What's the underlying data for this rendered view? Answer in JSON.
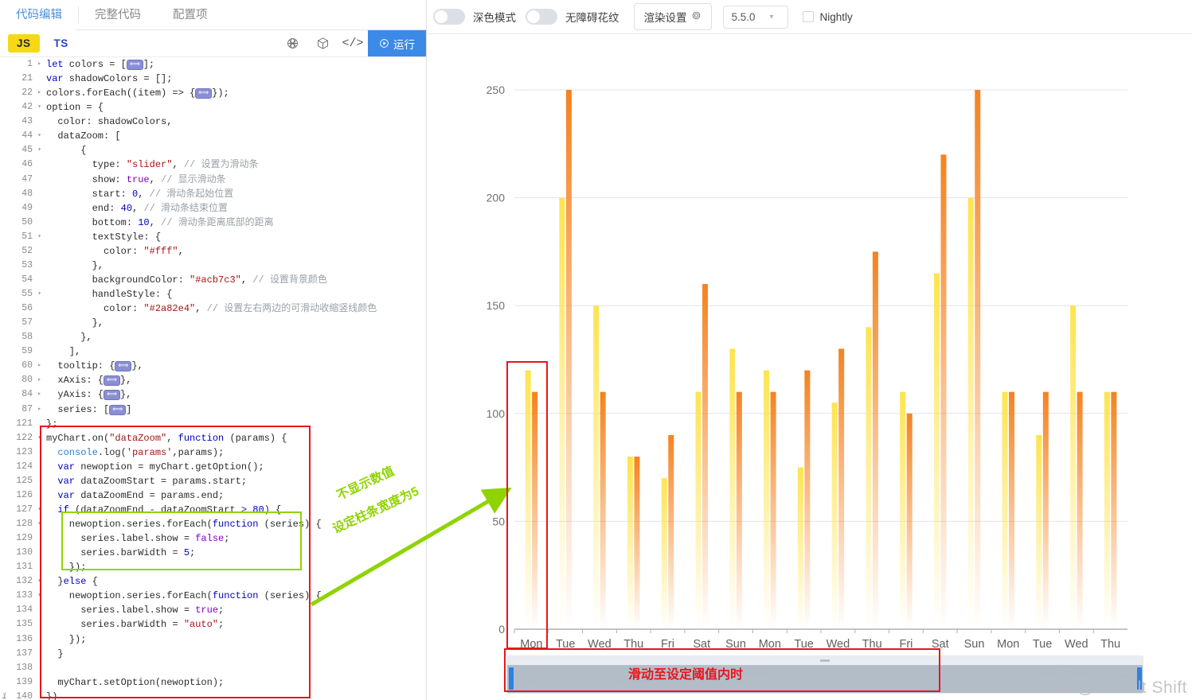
{
  "left_panel": {
    "tabs": [
      {
        "label": "代码编辑",
        "active": true
      },
      {
        "label": "完整代码",
        "active": false
      },
      {
        "label": "配置项",
        "active": false
      }
    ],
    "toolbar": {
      "lang_js": "JS",
      "lang_ts": "TS",
      "icon_globe": "globe-wireframe-icon",
      "icon_cube": "cube-icon",
      "icon_code": "</>",
      "run_label": "运行"
    },
    "code_lines": [
      {
        "n": "1",
        "fold": "▸",
        "html": "<span class='kw'>let</span> colors = [<span class='collapsed'>⟺</span>];"
      },
      {
        "n": "21",
        "fold": "",
        "html": "<span class='kw'>var</span> shadowColors = [];"
      },
      {
        "n": "22",
        "fold": "▸",
        "html": "colors.forEach((item) =&gt; {<span class='collapsed'>⟺</span>});"
      },
      {
        "n": "42",
        "fold": "▾",
        "html": "option = {"
      },
      {
        "n": "43",
        "fold": "",
        "html": "  color: shadowColors,"
      },
      {
        "n": "44",
        "fold": "▾",
        "html": "  dataZoom: ["
      },
      {
        "n": "45",
        "fold": "▾",
        "html": "      {"
      },
      {
        "n": "46",
        "fold": "",
        "html": "        type: <span class='str'>\"slider\"</span>, <span class='cmt'>// 设置为滑动条</span>"
      },
      {
        "n": "47",
        "fold": "",
        "html": "        show: <span class='kw2'>true</span>, <span class='cmt'>// 显示滑动条</span>"
      },
      {
        "n": "48",
        "fold": "",
        "html": "        start: <span class='num'>0</span>, <span class='cmt'>// 滑动条起始位置</span>"
      },
      {
        "n": "49",
        "fold": "",
        "html": "        end: <span class='num'>40</span>, <span class='cmt'>// 滑动条结束位置</span>"
      },
      {
        "n": "50",
        "fold": "",
        "html": "        bottom: <span class='num'>10</span>, <span class='cmt'>// 滑动条距离底部的距离</span>"
      },
      {
        "n": "51",
        "fold": "▾",
        "html": "        textStyle: {"
      },
      {
        "n": "52",
        "fold": "",
        "html": "          color: <span class='str'>\"#fff\"</span>,"
      },
      {
        "n": "53",
        "fold": "",
        "html": "        },"
      },
      {
        "n": "54",
        "fold": "",
        "html": "        backgroundColor: <span class='str'>\"#acb7c3\"</span>, <span class='cmt'>// 设置背景颜色</span>"
      },
      {
        "n": "55",
        "fold": "▾",
        "html": "        handleStyle: {"
      },
      {
        "n": "56",
        "fold": "",
        "html": "          color: <span class='str'>\"#2a82e4\"</span>, <span class='cmt'>// 设置左右两边的可滑动收缩竖线颜色</span>"
      },
      {
        "n": "57",
        "fold": "",
        "html": "        },"
      },
      {
        "n": "58",
        "fold": "",
        "html": "      },"
      },
      {
        "n": "59",
        "fold": "",
        "html": "    ],"
      },
      {
        "n": "60",
        "fold": "▸",
        "html": "  tooltip: {<span class='collapsed'>⟺</span>},"
      },
      {
        "n": "80",
        "fold": "▸",
        "html": "  xAxis: {<span class='collapsed'>⟺</span>},"
      },
      {
        "n": "84",
        "fold": "▸",
        "html": "  yAxis: {<span class='collapsed'>⟺</span>},"
      },
      {
        "n": "87",
        "fold": "▸",
        "html": "  series: [<span class='collapsed'>⟺</span>]"
      },
      {
        "n": "121",
        "fold": "",
        "html": "};"
      },
      {
        "n": "122",
        "fold": "▾",
        "html": "myChart.on(<span class='str'>\"dataZoom\"</span>, <span class='kw'>function</span> (params) {"
      },
      {
        "n": "123",
        "fold": "",
        "html": "  <span class='fn'>console</span>.log(<span class='str'>'params'</span>,params);"
      },
      {
        "n": "124",
        "fold": "",
        "html": "  <span class='kw'>var</span> newoption = myChart.getOption();"
      },
      {
        "n": "125",
        "fold": "",
        "html": "  <span class='kw'>var</span> dataZoomStart = params.start;"
      },
      {
        "n": "126",
        "fold": "",
        "html": "  <span class='kw'>var</span> dataZoomEnd = params.end;"
      },
      {
        "n": "127",
        "fold": "▾",
        "html": "  <span class='kw'>if</span> (dataZoomEnd - dataZoomStart &gt; <span class='num'>80</span>) {"
      },
      {
        "n": "128",
        "fold": "▾",
        "html": "    newoption.series.forEach(<span class='kw'>function</span> (series) {"
      },
      {
        "n": "129",
        "fold": "",
        "html": "      series.label.show = <span class='kw2'>false</span>;"
      },
      {
        "n": "130",
        "fold": "",
        "html": "      series.barWidth = <span class='num'>5</span>;"
      },
      {
        "n": "131",
        "fold": "",
        "html": "    });"
      },
      {
        "n": "132",
        "fold": "▾",
        "html": "  }<span class='kw'>else</span> {"
      },
      {
        "n": "133",
        "fold": "▾",
        "html": "    newoption.series.forEach(<span class='kw'>function</span> (series) {"
      },
      {
        "n": "134",
        "fold": "",
        "html": "      series.label.show = <span class='kw2'>true</span>;"
      },
      {
        "n": "135",
        "fold": "",
        "html": "      series.barWidth = <span class='str'>\"auto\"</span>;"
      },
      {
        "n": "136",
        "fold": "",
        "html": "    });"
      },
      {
        "n": "137",
        "fold": "",
        "html": "  }"
      },
      {
        "n": "138",
        "fold": "",
        "html": ""
      },
      {
        "n": "139",
        "fold": "",
        "html": "  myChart.setOption(newoption);"
      },
      {
        "n": "140",
        "fold": "",
        "gutter_icon": "i",
        "html": "})"
      }
    ]
  },
  "top_toolbar": {
    "dark_mode_label": "深色模式",
    "dark_mode_on": false,
    "pattern_label": "无障碍花纹",
    "pattern_on": false,
    "render_settings_label": "渲染设置",
    "render_settings_icon": "gear-icon",
    "version": "5.5.0",
    "nightly_label": "Nightly",
    "nightly_checked": false
  },
  "annotations": {
    "green_line1": "不显示数值",
    "green_line2": "设定柱条宽度为5",
    "slider_note": "滑动至设定阈值内时",
    "watermark": "CSDN @Ctrl Alt Shift"
  },
  "colors": {
    "accent_blue": "#3b8ae8",
    "bar_yellow": "#fde44f",
    "bar_orange": "#f58220",
    "annotation_red": "#e8161d",
    "annotation_green": "#8fd400",
    "slider_fill": "#acb7c3",
    "slider_handle": "#2a82e4"
  },
  "chart_data": {
    "type": "bar",
    "title": "",
    "xlabel": "",
    "ylabel": "",
    "ylim": [
      0,
      250
    ],
    "yticks": [
      0,
      50,
      100,
      150,
      200,
      250
    ],
    "grid": true,
    "legend": "none",
    "categories": [
      "Mon",
      "Tue",
      "Wed",
      "Thu",
      "Fri",
      "Sat",
      "Sun",
      "Mon",
      "Tue",
      "Wed",
      "Thu",
      "Fri",
      "Sat",
      "Sun",
      "Mon",
      "Tue",
      "Wed",
      "Thu"
    ],
    "series": [
      {
        "name": "yellow",
        "color": "#fde44f",
        "values": [
          120,
          200,
          150,
          80,
          70,
          110,
          130,
          120,
          75,
          105,
          140,
          110,
          165,
          200,
          110,
          90,
          150,
          110
        ]
      },
      {
        "name": "orange",
        "color": "#f58220",
        "values": [
          110,
          250,
          110,
          80,
          90,
          160,
          110,
          110,
          120,
          130,
          175,
          100,
          220,
          250,
          110,
          110,
          110,
          110
        ]
      }
    ],
    "dataZoom": {
      "start": 0,
      "end": 100,
      "type": "slider"
    }
  }
}
